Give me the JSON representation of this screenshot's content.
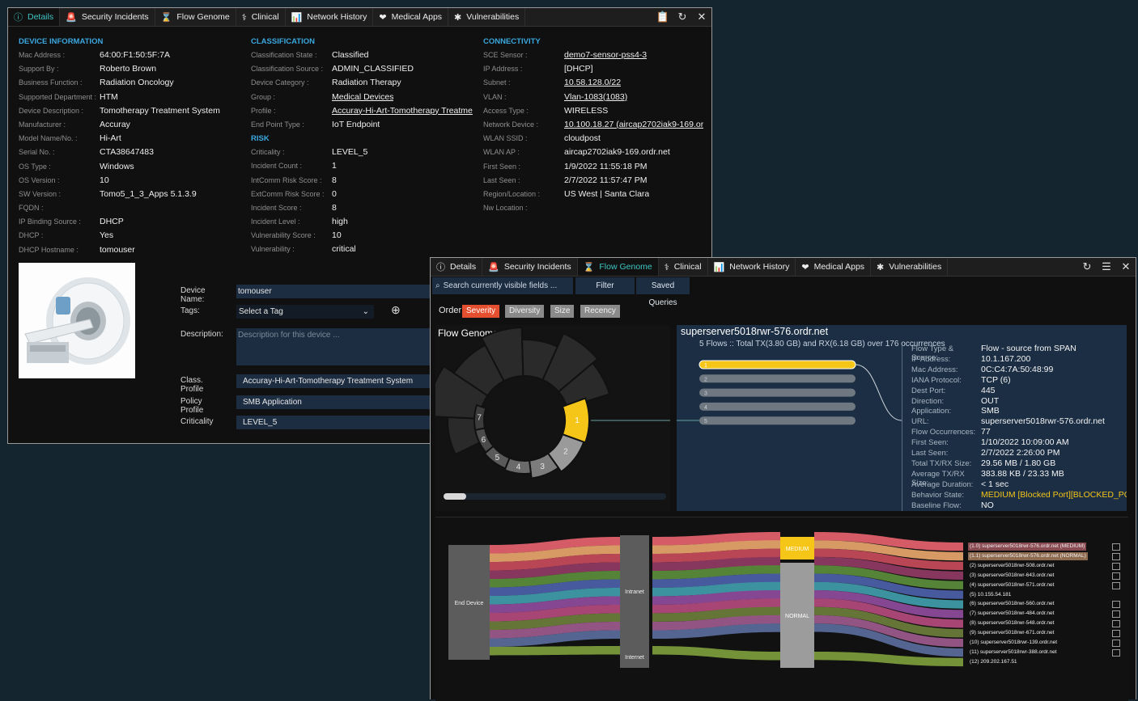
{
  "colors": {
    "accent": "#3ec6c3",
    "section": "#3aa8df",
    "severity_medium": "#f5c518",
    "order_active": "#e4502f"
  },
  "details_window": {
    "tabs": [
      {
        "label": "Details",
        "icon": "info-icon"
      },
      {
        "label": "Security Incidents",
        "icon": "alarm-icon"
      },
      {
        "label": "Flow Genome",
        "icon": "hourglass-icon"
      },
      {
        "label": "Clinical",
        "icon": "clinical-icon"
      },
      {
        "label": "Network History",
        "icon": "bar-chart-icon"
      },
      {
        "label": "Medical Apps",
        "icon": "heart-icon"
      },
      {
        "label": "Vulnerabilities",
        "icon": "bug-icon"
      }
    ],
    "device_information": {
      "title": "DEVICE INFORMATION",
      "rows": [
        {
          "label": "Mac Address :",
          "value": "64:00:F1:50:5F:7A"
        },
        {
          "label": "Support By :",
          "value": "Roberto Brown"
        },
        {
          "label": "Business Function :",
          "value": "Radiation Oncology"
        },
        {
          "label": "Supported Department :",
          "value": "HTM"
        },
        {
          "label": "Device Description :",
          "value": "Tomotherapy Treatment System"
        },
        {
          "label": "Manufacturer :",
          "value": "Accuray"
        },
        {
          "label": "Model Name/No. :",
          "value": "Hi-Art"
        },
        {
          "label": "Serial No. :",
          "value": "CTA38647483"
        },
        {
          "label": "OS Type :",
          "value": "Windows"
        },
        {
          "label": "OS Version :",
          "value": "10"
        },
        {
          "label": "SW Version :",
          "value": "Tomo5_1_3_Apps 5.1.3.9"
        },
        {
          "label": "FQDN :",
          "value": ""
        },
        {
          "label": "IP Binding Source :",
          "value": "DHCP"
        },
        {
          "label": "DHCP :",
          "value": "Yes"
        },
        {
          "label": "DHCP Hostname :",
          "value": "tomouser"
        }
      ]
    },
    "classification": {
      "title": "CLASSIFICATION",
      "rows": [
        {
          "label": "Classification State :",
          "value": "Classified"
        },
        {
          "label": "Classification Source :",
          "value": "ADMIN_CLASSIFIED"
        },
        {
          "label": "Device Category :",
          "value": "Radiation Therapy"
        },
        {
          "label": "Group :",
          "value": "Medical Devices"
        },
        {
          "label": "Profile :",
          "value": "Accuray-Hi-Art-Tomotherapy Treatme"
        },
        {
          "label": "End Point Type :",
          "value": "IoT Endpoint"
        }
      ]
    },
    "risk": {
      "title": "RISK",
      "rows": [
        {
          "label": "Criticality :",
          "value": "LEVEL_5"
        },
        {
          "label": "Incident Count :",
          "value": "1"
        },
        {
          "label": "IntComm Risk Score :",
          "value": "8"
        },
        {
          "label": "ExtComm Risk Score :",
          "value": "0"
        },
        {
          "label": "Incident Score :",
          "value": "8"
        },
        {
          "label": "Incident Level :",
          "value": "high"
        },
        {
          "label": "Vulnerability Score :",
          "value": "10"
        },
        {
          "label": "Vulnerability :",
          "value": "critical"
        }
      ]
    },
    "connectivity": {
      "title": "CONNECTIVITY",
      "rows": [
        {
          "label": "SCE Sensor :",
          "value": "demo7-sensor-pss4-3"
        },
        {
          "label": "IP Address :",
          "value": "[DHCP]"
        },
        {
          "label": "Subnet :",
          "value": "10.58.128.0/22"
        },
        {
          "label": "VLAN :",
          "value": "Vlan-1083(1083)"
        },
        {
          "label": "Access Type :",
          "value": "WIRELESS"
        },
        {
          "label": "Network Device :",
          "value": "10.100.18.27 (aircap2702iak9-169.or"
        },
        {
          "label": "WLAN SSID :",
          "value": "cloudpost"
        },
        {
          "label": "WLAN AP :",
          "value": "aircap2702iak9-169.ordr.net"
        },
        {
          "label": "First Seen :",
          "value": "1/9/2022 11:55:18 PM"
        },
        {
          "label": "Last Seen :",
          "value": "2/7/2022 11:57:47 PM"
        },
        {
          "label": "Region/Location :",
          "value": "US West | Santa Clara"
        },
        {
          "label": "Nw Location :",
          "value": ""
        }
      ]
    },
    "form": {
      "device_name_label": "Device Name:",
      "device_name_value": "tomouser",
      "tags_label": "Tags:",
      "tags_value": "Select a Tag",
      "description_label": "Description:",
      "description_placeholder": "Description for this device ...",
      "class_profile_label": "Class. Profile",
      "class_profile_value": "Accuray-Hi-Art-Tomotherapy Treatment System",
      "policy_profile_label": "Policy Profile",
      "policy_profile_value": "SMB Application",
      "criticality_label": "Criticality",
      "criticality_value": "LEVEL_5"
    }
  },
  "flow_window": {
    "tabs": [
      {
        "label": "Details",
        "icon": "info-icon"
      },
      {
        "label": "Security Incidents",
        "icon": "alarm-icon"
      },
      {
        "label": "Flow Genome",
        "icon": "hourglass-icon"
      },
      {
        "label": "Clinical",
        "icon": "clinical-icon"
      },
      {
        "label": "Network History",
        "icon": "bar-chart-icon"
      },
      {
        "label": "Medical Apps",
        "icon": "heart-icon"
      },
      {
        "label": "Vulnerabilities",
        "icon": "bug-icon"
      }
    ],
    "search_placeholder": "Search currently visible fields ...",
    "filter_label": "Filter",
    "saved_queries_label": "Saved Queries",
    "order_label": "Order:",
    "order_options": [
      "Severity",
      "Diversity",
      "Size",
      "Recency"
    ],
    "genome_title": "Flow Genome",
    "genome_segments": [
      "1",
      "2",
      "3",
      "4",
      "5",
      "6",
      "7"
    ],
    "server_title": "superserver5018rwr-576.ordr.net",
    "server_subtitle": "5 Flows :: Total TX(3.80 GB) and RX(6.18 GB) over 176 occurrences",
    "flow_bars": [
      "1",
      "2",
      "3",
      "4",
      "5"
    ],
    "flow_details": [
      {
        "label": "Flow Type & Source:",
        "value": "Flow - source from SPAN"
      },
      {
        "label": "IP Address:",
        "value": "10.1.167.200"
      },
      {
        "label": "Mac Address:",
        "value": "0C:C4:7A:50:48:99"
      },
      {
        "label": "IANA Protocol:",
        "value": "TCP (6)"
      },
      {
        "label": "Dest Port:",
        "value": "445"
      },
      {
        "label": "Direction:",
        "value": "OUT"
      },
      {
        "label": "Application:",
        "value": "SMB"
      },
      {
        "label": "URL:",
        "value": "superserver5018rwr-576.ordr.net"
      },
      {
        "label": "Flow Occurrences:",
        "value": "77"
      },
      {
        "label": "First Seen:",
        "value": "1/10/2022 10:09:00 AM"
      },
      {
        "label": "Last Seen:",
        "value": "2/7/2022 2:26:00 PM"
      },
      {
        "label": "Total TX/RX Size:",
        "value": "29.56 MB / 1.80 GB"
      },
      {
        "label": "Average TX/RX Size:",
        "value": "383.88 KB / 23.33 MB"
      },
      {
        "label": "Average Duration:",
        "value": "< 1 sec"
      },
      {
        "label": "Behavior State:",
        "value": "MEDIUM [Blocked Port][BLOCKED_PC"
      },
      {
        "label": "Baseline Flow:",
        "value": "NO"
      }
    ],
    "sankey": {
      "nodes": {
        "end_device": "End Device",
        "intranet": "Intranet",
        "internet": "Internet",
        "medium": "MEDIUM",
        "normal": "NORMAL"
      },
      "destinations": [
        "(1.0) superserver5018rwr-576.ordr.net (MEDIUM)",
        "(1.1) superserver5018rwr-576.ordr.net (NORMAL)",
        "(2) superserver5018rwr-508.ordr.net",
        "(3) superserver5018rwr-643.ordr.net",
        "(4) superserver5018rwr-571.ordr.net",
        "(5) 10.155.54.181",
        "(6) superserver5018rwr-560.ordr.net",
        "(7) superserver5018rwr-484.ordr.net",
        "(8) superserver5018rwr-548.ordr.net",
        "(9) superserver5018rwr-671.ordr.net",
        "(10) superserver5018rwr-139.ordr.net",
        "(11) superserver5018rwr-388.ordr.net",
        "(12) 209.202.167.51"
      ],
      "flow_colors": [
        "#e0606c",
        "#e4a26a",
        "#c24a5a",
        "#8e3a62",
        "#5a8a3a",
        "#4c5fa6",
        "#3f9aa8",
        "#8c4a9a",
        "#b04a7a",
        "#6a7a3a",
        "#9a5a8a",
        "#5a6a9a",
        "#7a9a3a"
      ]
    }
  }
}
